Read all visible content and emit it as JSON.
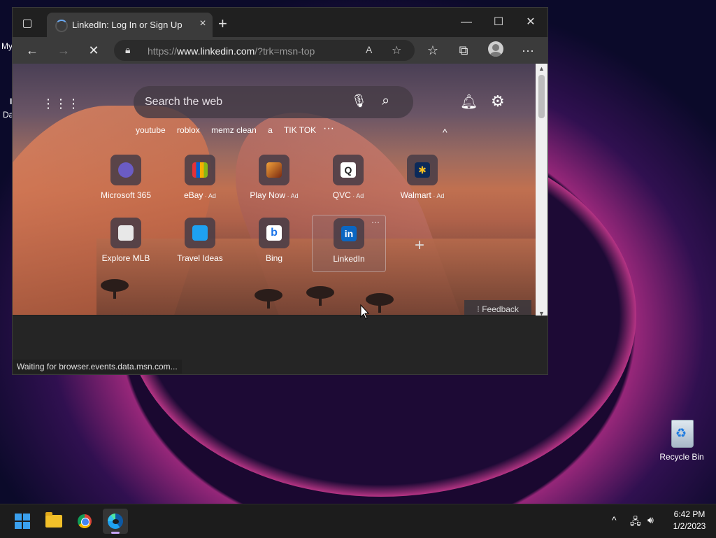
{
  "desktop": {
    "edge_text_1": "My",
    "edge_text_2": "I",
    "edge_text_3": "Da",
    "recycle_bin_label": "Recycle Bin"
  },
  "browser": {
    "tab": {
      "title": "LinkedIn: Log In or Sign Up",
      "close": "×"
    },
    "new_tab": "+",
    "window_controls": {
      "minimize": "—",
      "maximize": "☐",
      "close": "✕"
    },
    "toolbar": {
      "back": "←",
      "forward": "→",
      "stop": "✕",
      "url_prefix": "https://",
      "url_domain": "www.linkedin.com",
      "url_path": "/?trk=msn-top",
      "read_aloud": "A",
      "add_favorite": "☆",
      "favorites": "☆",
      "collections": "⧉",
      "more": "···"
    },
    "status_text": "Waiting for browser.events.data.msn.com..."
  },
  "newtab_page": {
    "search_placeholder": "Search the web",
    "quick_links": [
      "youtube",
      "roblox",
      "memz clean",
      "a",
      "TIK TOK"
    ],
    "quick_links_more": "···",
    "collapse": "^",
    "tiles_row1": [
      {
        "label": "Microsoft 365",
        "ad": "",
        "color": "#6b5cc4"
      },
      {
        "label": "eBay",
        "ad": " · Ad",
        "color": "#e53238"
      },
      {
        "label": "Play Now",
        "ad": " · Ad",
        "color": "#c06a20"
      },
      {
        "label": "QVC",
        "ad": " · Ad",
        "color": "#ffffff"
      },
      {
        "label": "Walmart",
        "ad": " · Ad",
        "color": "#0071ce"
      }
    ],
    "tiles_row2": [
      {
        "label": "Explore MLB",
        "color": "#dddddd"
      },
      {
        "label": "Travel Ideas",
        "color": "#1ea1f1"
      },
      {
        "label": "Bing",
        "color": "#ffffff"
      },
      {
        "label": "LinkedIn",
        "color": "#0a66c2"
      }
    ],
    "tile_more": "···",
    "add_tile": "+",
    "feedback": "Feedback"
  },
  "taskbar": {
    "time": "6:42 PM",
    "date": "1/2/2023",
    "tray_chevron": "^"
  }
}
